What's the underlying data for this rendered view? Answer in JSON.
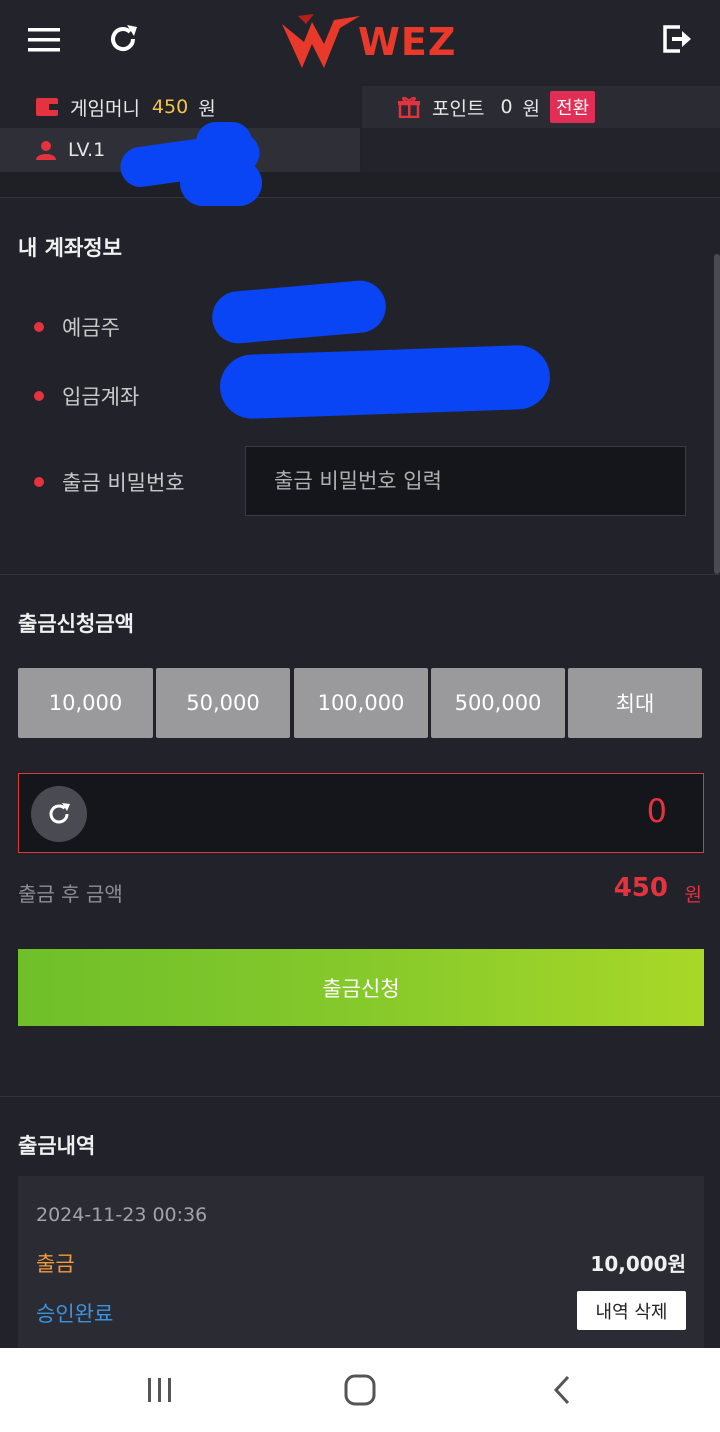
{
  "header": {
    "logo_text": "WEZ",
    "icons": {
      "menu": "menu-icon",
      "refresh": "refresh-icon",
      "logout": "logout-icon"
    }
  },
  "info": {
    "game_money_label": "게임머니",
    "game_money_value": "450",
    "game_money_unit": "원",
    "point_label": "포인트",
    "point_value": "0",
    "point_unit": "원",
    "convert_label": "전환",
    "level": "LV.1"
  },
  "account": {
    "title": "내 계좌정보",
    "holder_label": "예금주",
    "account_label": "입금계좌",
    "password_label": "출금 비밀번호",
    "password_placeholder": "출금 비밀번호 입력"
  },
  "withdraw": {
    "title": "출금신청금액",
    "amount_buttons": [
      "10,000",
      "50,000",
      "100,000",
      "500,000",
      "최대"
    ],
    "amount_value": "0",
    "after_label": "출금 후 금액",
    "after_value": "450",
    "after_unit": "원",
    "submit_label": "출금신청"
  },
  "history": {
    "title": "출금내역",
    "items": [
      {
        "date": "2024-11-23 00:36",
        "type": "출금",
        "amount": "10,000원",
        "status": "승인완료",
        "delete_label": "내역 삭제"
      }
    ]
  },
  "colors": {
    "accent_red": "#e5323f",
    "gold": "#f5c34a",
    "green_start": "#6fbf2a",
    "green_end": "#a8d828",
    "status_blue": "#3a93e0",
    "type_orange": "#f39a3a"
  }
}
